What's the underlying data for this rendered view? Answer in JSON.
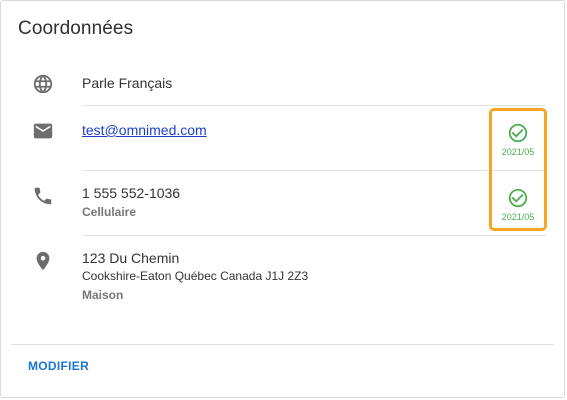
{
  "card": {
    "title": "Coordonnées",
    "language": {
      "text": "Parle Français",
      "icon": "globe-icon"
    },
    "email": {
      "address": "test@omnimed.com",
      "icon": "email-icon",
      "verified_date": "2021/05",
      "verified_icon": "check-circle-icon"
    },
    "phone": {
      "number": "1 555 552-1036",
      "type": "Cellulaire",
      "icon": "phone-icon",
      "verified_date": "2021/05",
      "verified_icon": "check-circle-icon"
    },
    "address": {
      "street": "123 Du Chemin",
      "city_line": "Cookshire-Eaton Québec Canada J1J 2Z3",
      "type": "Maison",
      "icon": "location-pin-icon"
    },
    "modify_label": "MODIFIER"
  },
  "colors": {
    "accent": "#1976d2",
    "verified": "#4caf50",
    "highlight": "#f5a623"
  }
}
